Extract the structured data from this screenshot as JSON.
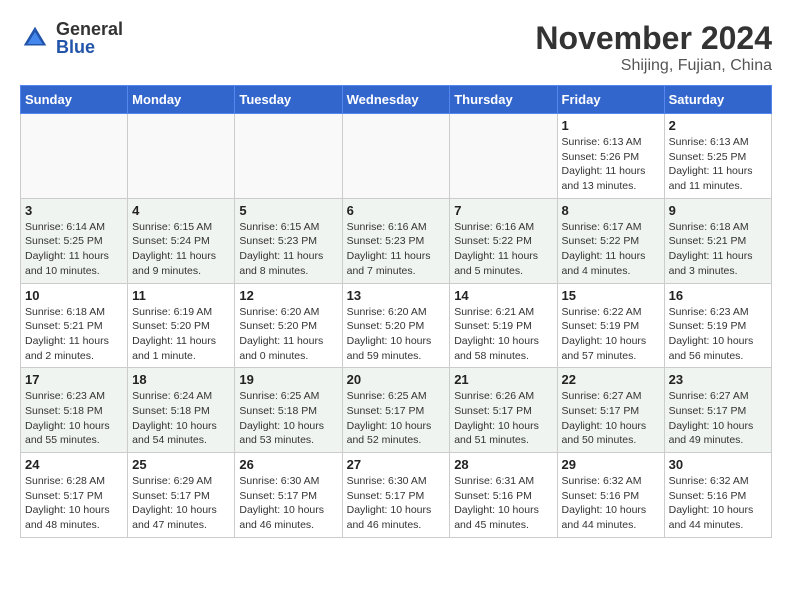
{
  "header": {
    "logo_general": "General",
    "logo_blue": "Blue",
    "month_title": "November 2024",
    "location": "Shijing, Fujian, China"
  },
  "weekdays": [
    "Sunday",
    "Monday",
    "Tuesday",
    "Wednesday",
    "Thursday",
    "Friday",
    "Saturday"
  ],
  "weeks": [
    [
      {
        "day": "",
        "info": ""
      },
      {
        "day": "",
        "info": ""
      },
      {
        "day": "",
        "info": ""
      },
      {
        "day": "",
        "info": ""
      },
      {
        "day": "",
        "info": ""
      },
      {
        "day": "1",
        "info": "Sunrise: 6:13 AM\nSunset: 5:26 PM\nDaylight: 11 hours and 13 minutes."
      },
      {
        "day": "2",
        "info": "Sunrise: 6:13 AM\nSunset: 5:25 PM\nDaylight: 11 hours and 11 minutes."
      }
    ],
    [
      {
        "day": "3",
        "info": "Sunrise: 6:14 AM\nSunset: 5:25 PM\nDaylight: 11 hours and 10 minutes."
      },
      {
        "day": "4",
        "info": "Sunrise: 6:15 AM\nSunset: 5:24 PM\nDaylight: 11 hours and 9 minutes."
      },
      {
        "day": "5",
        "info": "Sunrise: 6:15 AM\nSunset: 5:23 PM\nDaylight: 11 hours and 8 minutes."
      },
      {
        "day": "6",
        "info": "Sunrise: 6:16 AM\nSunset: 5:23 PM\nDaylight: 11 hours and 7 minutes."
      },
      {
        "day": "7",
        "info": "Sunrise: 6:16 AM\nSunset: 5:22 PM\nDaylight: 11 hours and 5 minutes."
      },
      {
        "day": "8",
        "info": "Sunrise: 6:17 AM\nSunset: 5:22 PM\nDaylight: 11 hours and 4 minutes."
      },
      {
        "day": "9",
        "info": "Sunrise: 6:18 AM\nSunset: 5:21 PM\nDaylight: 11 hours and 3 minutes."
      }
    ],
    [
      {
        "day": "10",
        "info": "Sunrise: 6:18 AM\nSunset: 5:21 PM\nDaylight: 11 hours and 2 minutes."
      },
      {
        "day": "11",
        "info": "Sunrise: 6:19 AM\nSunset: 5:20 PM\nDaylight: 11 hours and 1 minute."
      },
      {
        "day": "12",
        "info": "Sunrise: 6:20 AM\nSunset: 5:20 PM\nDaylight: 11 hours and 0 minutes."
      },
      {
        "day": "13",
        "info": "Sunrise: 6:20 AM\nSunset: 5:20 PM\nDaylight: 10 hours and 59 minutes."
      },
      {
        "day": "14",
        "info": "Sunrise: 6:21 AM\nSunset: 5:19 PM\nDaylight: 10 hours and 58 minutes."
      },
      {
        "day": "15",
        "info": "Sunrise: 6:22 AM\nSunset: 5:19 PM\nDaylight: 10 hours and 57 minutes."
      },
      {
        "day": "16",
        "info": "Sunrise: 6:23 AM\nSunset: 5:19 PM\nDaylight: 10 hours and 56 minutes."
      }
    ],
    [
      {
        "day": "17",
        "info": "Sunrise: 6:23 AM\nSunset: 5:18 PM\nDaylight: 10 hours and 55 minutes."
      },
      {
        "day": "18",
        "info": "Sunrise: 6:24 AM\nSunset: 5:18 PM\nDaylight: 10 hours and 54 minutes."
      },
      {
        "day": "19",
        "info": "Sunrise: 6:25 AM\nSunset: 5:18 PM\nDaylight: 10 hours and 53 minutes."
      },
      {
        "day": "20",
        "info": "Sunrise: 6:25 AM\nSunset: 5:17 PM\nDaylight: 10 hours and 52 minutes."
      },
      {
        "day": "21",
        "info": "Sunrise: 6:26 AM\nSunset: 5:17 PM\nDaylight: 10 hours and 51 minutes."
      },
      {
        "day": "22",
        "info": "Sunrise: 6:27 AM\nSunset: 5:17 PM\nDaylight: 10 hours and 50 minutes."
      },
      {
        "day": "23",
        "info": "Sunrise: 6:27 AM\nSunset: 5:17 PM\nDaylight: 10 hours and 49 minutes."
      }
    ],
    [
      {
        "day": "24",
        "info": "Sunrise: 6:28 AM\nSunset: 5:17 PM\nDaylight: 10 hours and 48 minutes."
      },
      {
        "day": "25",
        "info": "Sunrise: 6:29 AM\nSunset: 5:17 PM\nDaylight: 10 hours and 47 minutes."
      },
      {
        "day": "26",
        "info": "Sunrise: 6:30 AM\nSunset: 5:17 PM\nDaylight: 10 hours and 46 minutes."
      },
      {
        "day": "27",
        "info": "Sunrise: 6:30 AM\nSunset: 5:17 PM\nDaylight: 10 hours and 46 minutes."
      },
      {
        "day": "28",
        "info": "Sunrise: 6:31 AM\nSunset: 5:16 PM\nDaylight: 10 hours and 45 minutes."
      },
      {
        "day": "29",
        "info": "Sunrise: 6:32 AM\nSunset: 5:16 PM\nDaylight: 10 hours and 44 minutes."
      },
      {
        "day": "30",
        "info": "Sunrise: 6:32 AM\nSunset: 5:16 PM\nDaylight: 10 hours and 44 minutes."
      }
    ]
  ]
}
